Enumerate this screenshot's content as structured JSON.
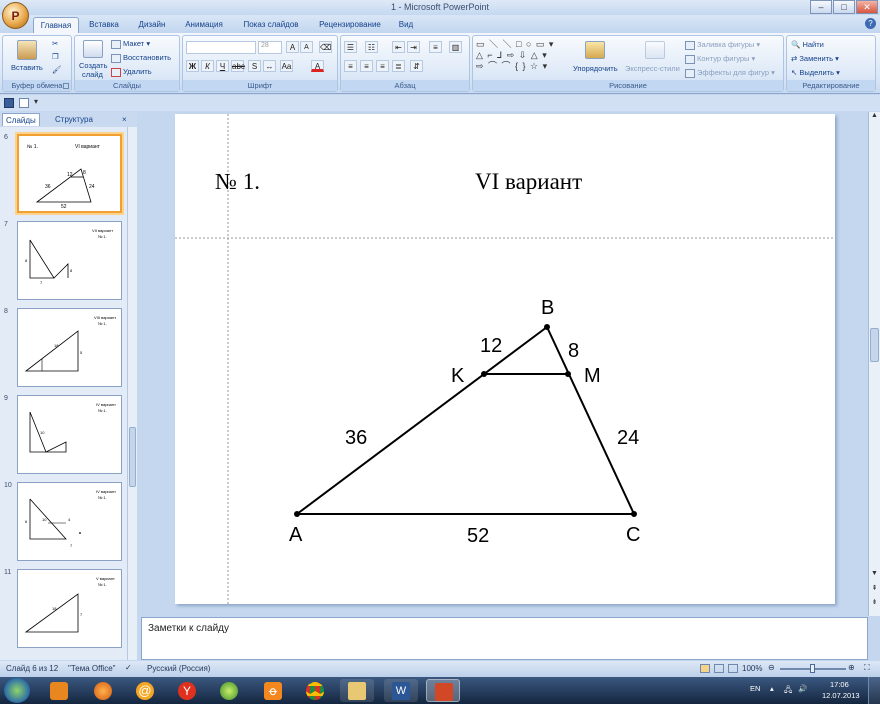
{
  "window": {
    "title": "1 - Microsoft PowerPoint",
    "office_button_glyph": "P"
  },
  "tabs": [
    "Главная",
    "Вставка",
    "Дизайн",
    "Анимация",
    "Показ слайдов",
    "Рецензирование",
    "Вид"
  ],
  "ribbon": {
    "clipboard": {
      "paste": "Вставить",
      "group": "Буфер обмена"
    },
    "slides": {
      "new_slide_line1": "Создать",
      "new_slide_line2": "слайд",
      "layout": "Макет",
      "reset": "Восстановить",
      "delete": "Удалить",
      "group": "Слайды"
    },
    "font": {
      "font_name": "",
      "font_size": "28",
      "group": "Шрифт"
    },
    "paragraph": {
      "group": "Абзац"
    },
    "drawing": {
      "arrange": "Упорядочить",
      "quick_styles": "Экспресс-стили",
      "shape_fill": "Заливка фигуры",
      "shape_outline": "Контур фигуры",
      "shape_effects": "Эффекты для фигур",
      "group": "Рисование"
    },
    "editing": {
      "find": "Найти",
      "replace": "Заменить",
      "select": "Выделить",
      "group": "Редактирование"
    }
  },
  "panel": {
    "tab_slides": "Слайды",
    "tab_outline": "Структура",
    "close": "×"
  },
  "thumbnails": [
    {
      "number": "6",
      "title_left": "№ 1.",
      "title_right": "VI вариант",
      "labels": [
        "12",
        "8",
        "36",
        "24",
        "52"
      ]
    },
    {
      "number": "7",
      "title_right": "VII вариант",
      "title_sub": "№ 1.",
      "labels": [
        "8",
        "7",
        "8"
      ]
    },
    {
      "number": "8",
      "title_right": "VIII вариант",
      "title_sub": "№ 1.",
      "labels": [
        "18",
        "5"
      ]
    },
    {
      "number": "9",
      "title_right": "IV вариант",
      "title_sub": "№ 1.",
      "labels": [
        "10"
      ]
    },
    {
      "number": "10",
      "title_right": "IV вариант",
      "title_sub": "№ 1.",
      "labels": [
        "6",
        "10",
        "4",
        "7"
      ]
    },
    {
      "number": "11",
      "title_right": "V вариант",
      "title_sub": "№ 1.",
      "labels": [
        "18",
        "7"
      ]
    }
  ],
  "slide": {
    "number_label": "№ 1.",
    "variant": "VI вариант",
    "vertices": {
      "A": "A",
      "B": "B",
      "C": "C",
      "K": "K",
      "M": "M"
    },
    "segments": {
      "AK": "36",
      "KB": "12",
      "BM": "8",
      "MC": "24",
      "AC": "52"
    }
  },
  "notes_placeholder": "Заметки к слайду",
  "status": {
    "slide_info": "Слайд 6 из 12",
    "theme": "\"Тема Office\"",
    "language": "Русский (Россия)",
    "zoom": "100%"
  },
  "taskbar": {
    "language": "EN",
    "time": "17:06",
    "date": "12.07.2013"
  }
}
